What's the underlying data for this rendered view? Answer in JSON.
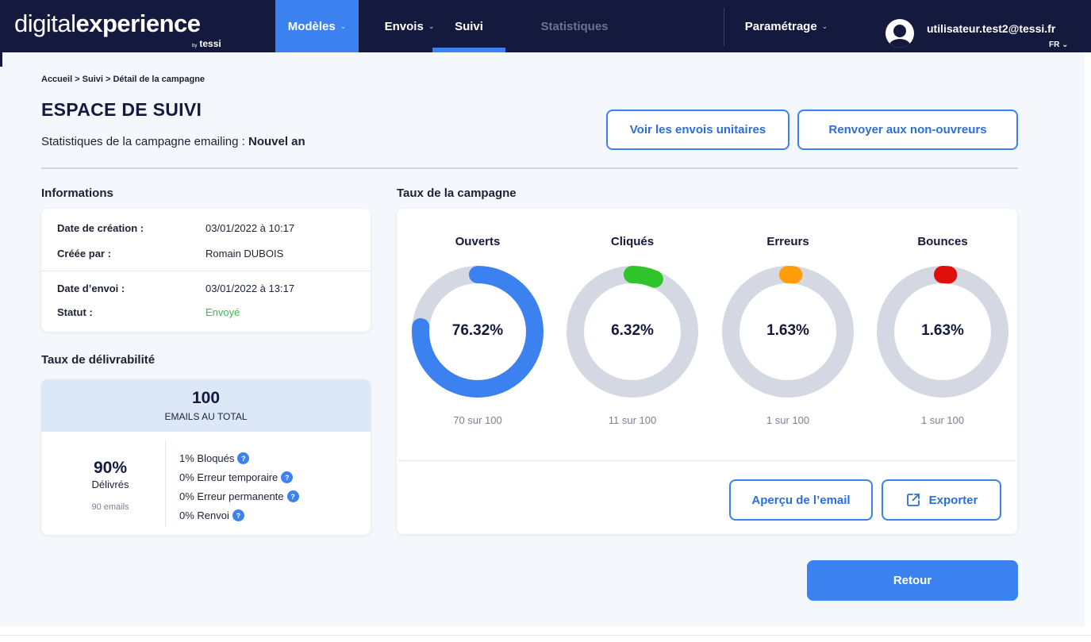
{
  "header": {
    "logo_light": "digital",
    "logo_bold": "experience",
    "logo_sub_by": "by",
    "logo_sub": "tessi",
    "nav": [
      {
        "label": "Modèles"
      },
      {
        "label": "Envois"
      },
      {
        "label": "Suivi"
      },
      {
        "label": "Statistiques"
      }
    ],
    "settings_label": "Paramétrage",
    "user_email": "utilisateur.test2@tessi.fr",
    "language": "FR",
    "chevron": "⌄"
  },
  "breadcrumb": "Accueil > Suivi > Détail de la campagne",
  "page": {
    "title": "ESPACE DE SUIVI",
    "subtitle_prefix": "Statistiques de la campagne emailing : ",
    "campaign_name": "Nouvel an",
    "btn_unit_sends": "Voir les envois unitaires",
    "btn_resend": "Renvoyer aux non-ouvreurs",
    "btn_back": "Retour"
  },
  "informations": {
    "title": "Informations",
    "rows": [
      {
        "label": "Date de création :",
        "value": "03/01/2022 à 10:17"
      },
      {
        "label": "Créée par :",
        "value": "Romain DUBOIS"
      },
      {
        "label": "Date d’envoi :",
        "value": "03/01/2022 à 13:17"
      },
      {
        "label": "Statut :",
        "value": "Envoyé"
      }
    ],
    "status_color": "#35c24a"
  },
  "deliverability": {
    "title": "Taux de délivrabilité",
    "total": "100",
    "total_label": "EMAILS AU TOTAL",
    "delivered_pct": "90%",
    "delivered_label": "Délivrés",
    "delivered_count": "90 emails",
    "help_glyph": "?",
    "items": [
      {
        "label": "1% Bloqués"
      },
      {
        "label": "0% Erreur temporaire"
      },
      {
        "label": "0% Erreur permanente"
      },
      {
        "label": "0% Renvoi"
      }
    ]
  },
  "campaign_rates": {
    "title": "Taux de la campagne",
    "track_color": "#d3d8e2",
    "items": [
      {
        "label": "Ouverts",
        "value_text": "76.32%",
        "percent": 76.32,
        "count_text": "70 sur 100",
        "color": "#3b82f0"
      },
      {
        "label": "Cliqués",
        "value_text": "6.32%",
        "percent": 6.32,
        "count_text": "11 sur 100",
        "color": "#2ec42a"
      },
      {
        "label": "Erreurs",
        "value_text": "1.63%",
        "percent": 1.63,
        "count_text": "1 sur 100",
        "color": "#ff9d0a"
      },
      {
        "label": "Bounces",
        "value_text": "1.63%",
        "percent": 1.63,
        "count_text": "1 sur 100",
        "color": "#e10e0e"
      }
    ],
    "btn_preview": "Aperçu de l’email",
    "btn_export": "Exporter"
  },
  "colors": {
    "navy": "#141a3d",
    "accent": "#3b82f0",
    "background": "#f4f7fb"
  }
}
